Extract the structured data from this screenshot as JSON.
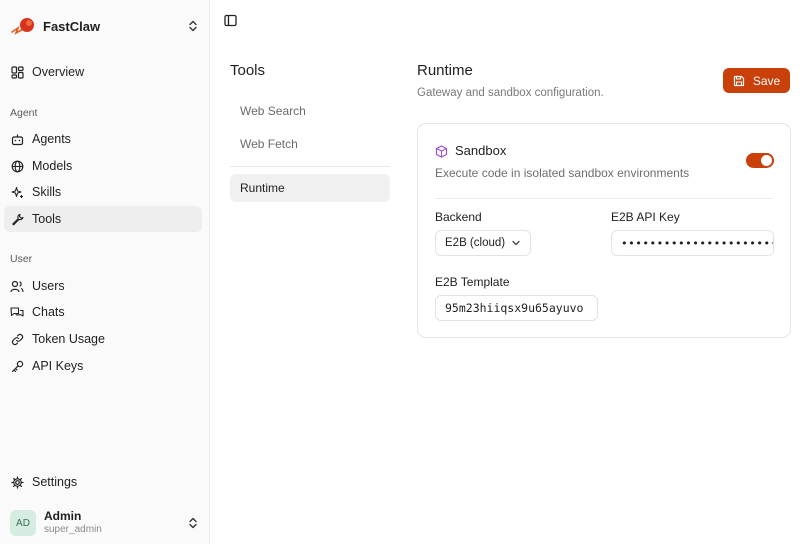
{
  "brand": {
    "name": "FastClaw"
  },
  "sidebar": {
    "top_items": [
      {
        "label": "Overview",
        "icon": "layout-dashboard-icon"
      }
    ],
    "sections": [
      {
        "label": "Agent",
        "items": [
          {
            "label": "Agents",
            "icon": "bot-icon"
          },
          {
            "label": "Models",
            "icon": "globe-icon"
          },
          {
            "label": "Skills",
            "icon": "sparkles-icon"
          },
          {
            "label": "Tools",
            "icon": "wrench-icon",
            "active": true
          }
        ]
      },
      {
        "label": "User",
        "items": [
          {
            "label": "Users",
            "icon": "users-icon"
          },
          {
            "label": "Chats",
            "icon": "messages-icon"
          },
          {
            "label": "Token Usage",
            "icon": "link-icon"
          },
          {
            "label": "API Keys",
            "icon": "key-icon"
          }
        ]
      }
    ],
    "settings_label": "Settings",
    "user": {
      "initials": "AD",
      "name": "Admin",
      "role": "super_admin"
    }
  },
  "tools_nav": {
    "title": "Tools",
    "items": [
      {
        "label": "Web Search"
      },
      {
        "label": "Web Fetch"
      },
      {
        "label": "Runtime",
        "active": true
      }
    ]
  },
  "page": {
    "title": "Runtime",
    "subtitle": "Gateway and sandbox configuration.",
    "save_label": "Save"
  },
  "sandbox": {
    "title": "Sandbox",
    "description": "Execute code in isolated sandbox environments",
    "enabled": true,
    "backend_label": "Backend",
    "backend_value": "E2B (cloud)",
    "api_key_label": "E2B API Key",
    "api_key_value": "••••••••••••••••••••••••",
    "template_label": "E2B Template",
    "template_value": "95m23hiiqsx9u65ayuvo"
  },
  "colors": {
    "accent": "#c9400a",
    "avatar_bg": "#d4ede0"
  }
}
